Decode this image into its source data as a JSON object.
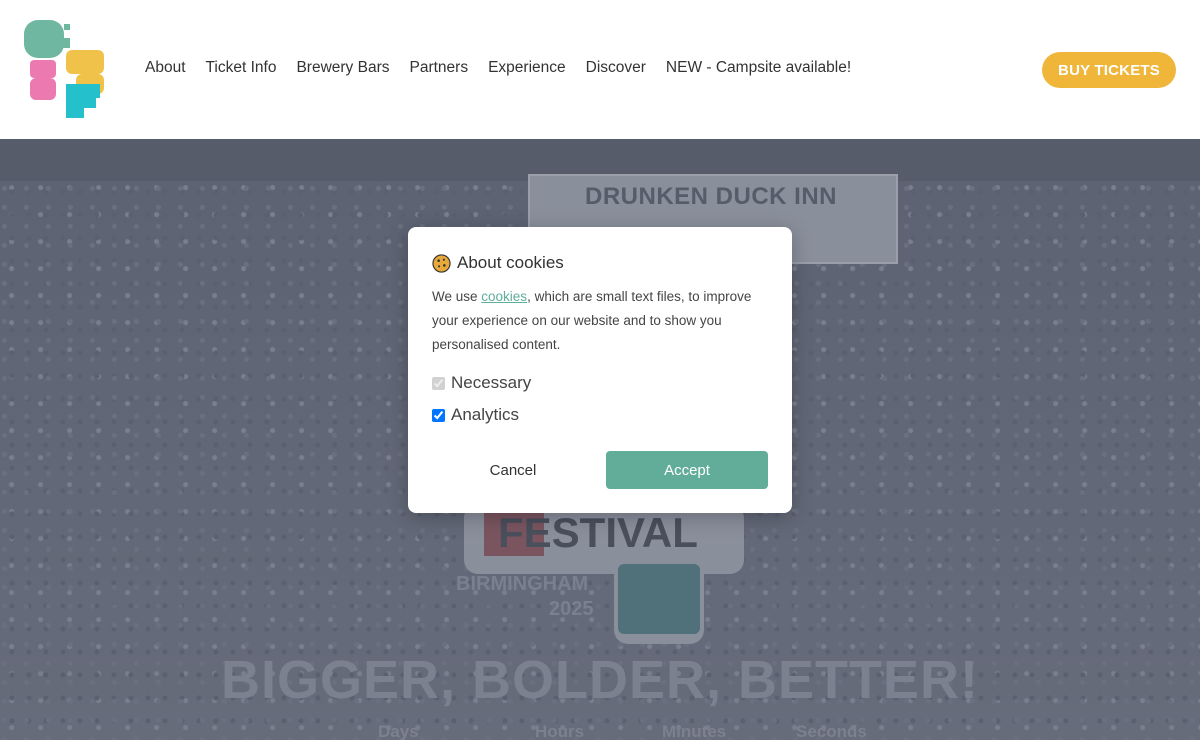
{
  "nav": {
    "items": [
      "About",
      "Ticket Info",
      "Brewery Bars",
      "Partners",
      "Experience",
      "Discover",
      "NEW - Campsite available!"
    ],
    "buy_tickets": "BUY TICKETS"
  },
  "hero": {
    "banner_text": "DRUNKEN DUCK INN",
    "festival": "FESTIVAL",
    "city": "BIRMINGHAM",
    "year": "2025",
    "tagline": "BIGGER, BOLDER, BETTER!",
    "countdown": [
      "Days",
      "Hours",
      "Minutes",
      "Seconds"
    ]
  },
  "cookie_modal": {
    "title": "About cookies",
    "body_before_link": "We use ",
    "link_text": "cookies",
    "body_after_link": ", which are small text files, to improve your experience on our website and to show you personalised content.",
    "options": [
      {
        "label": "Necessary",
        "checked": true,
        "disabled": true
      },
      {
        "label": "Analytics",
        "checked": true,
        "disabled": false
      }
    ],
    "cancel": "Cancel",
    "accept": "Accept"
  },
  "colors": {
    "accent_orange": "#f0b63a",
    "accept_teal": "#61ad99",
    "logo_green": "#6fb7a0",
    "logo_pink": "#ec7ab1",
    "logo_yellow": "#f1c24a",
    "logo_cyan": "#24c1cc"
  }
}
